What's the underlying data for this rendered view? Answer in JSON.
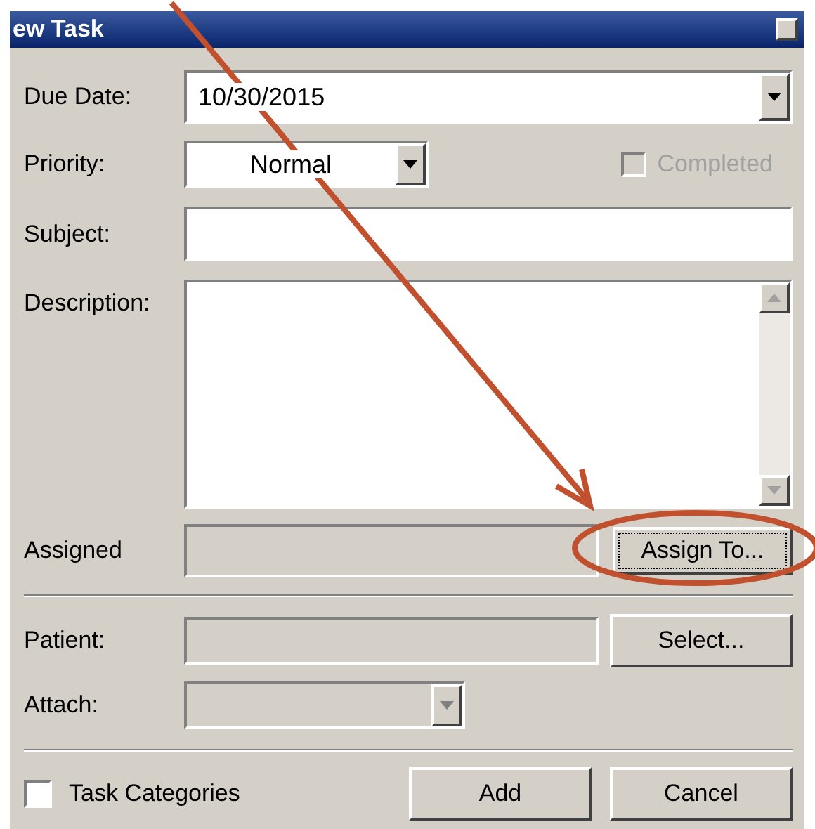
{
  "window": {
    "title": "ew Task"
  },
  "fields": {
    "due_date": {
      "label": "Due Date:",
      "value": "10/30/2015"
    },
    "priority": {
      "label": "Priority:",
      "value": "Normal"
    },
    "completed": {
      "label": "Completed",
      "checked": false,
      "disabled": true
    },
    "subject": {
      "label": "Subject:"
    },
    "description": {
      "label": "Description:"
    },
    "assigned": {
      "label": "Assigned",
      "button": "Assign To..."
    },
    "patient": {
      "label": "Patient:",
      "button": "Select..."
    },
    "attach": {
      "label": "Attach:",
      "disabled": true
    }
  },
  "footer": {
    "task_categories": {
      "label": "Task Categories",
      "checked": false
    },
    "buttons": [
      "Add",
      "Cancel"
    ]
  }
}
